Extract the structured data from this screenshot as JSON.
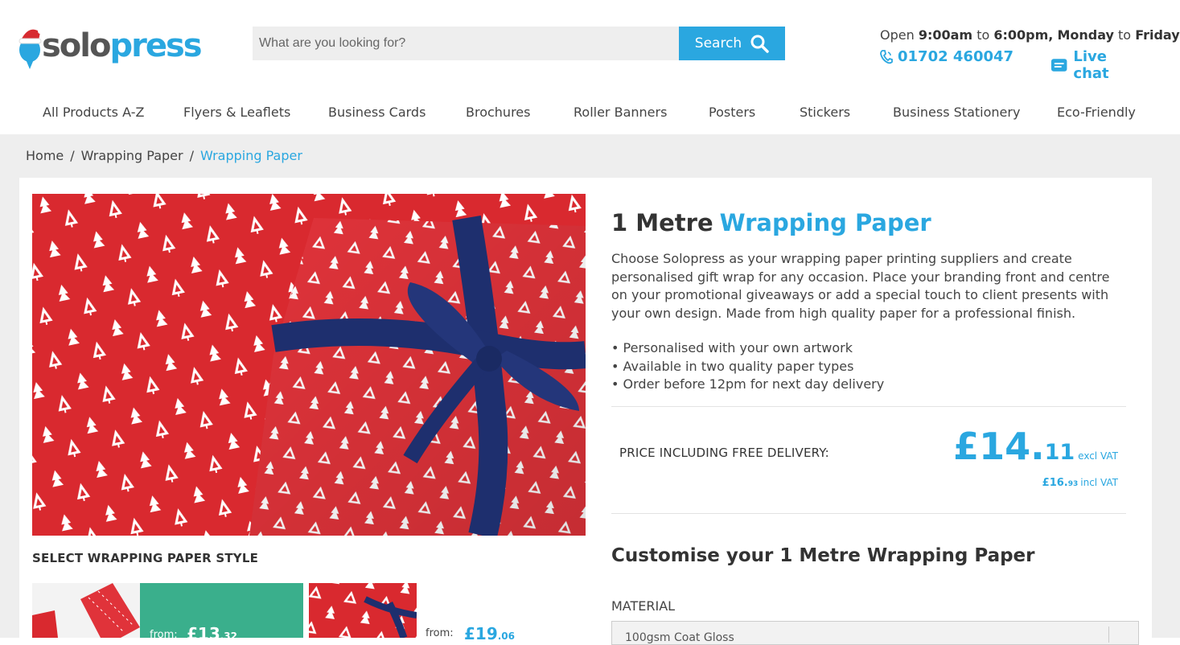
{
  "brand": {
    "logo_text_1": "solo",
    "logo_text_2": "press",
    "accent": "#2aa7e0",
    "green": "#3aaf8c"
  },
  "search": {
    "placeholder": "What are you looking for?",
    "button_label": "Search"
  },
  "hours": {
    "open_word": "Open",
    "open_time": "9:00am",
    "to1": "to",
    "close_time": "6:00pm,",
    "day_start": "Monday",
    "to2": "to",
    "day_end": "Friday"
  },
  "contact": {
    "phone": "01702 460047",
    "chat": "Live chat"
  },
  "nav": [
    {
      "label": "All Products A-Z"
    },
    {
      "label": "Flyers & Leaflets"
    },
    {
      "label": "Business Cards"
    },
    {
      "label": "Brochures"
    },
    {
      "label": "Roller Banners"
    },
    {
      "label": "Posters"
    },
    {
      "label": "Stickers"
    },
    {
      "label": "Business Stationery"
    },
    {
      "label": "Eco-Friendly"
    }
  ],
  "breadcrumb": {
    "items": [
      "Home",
      "Wrapping Paper",
      "Wrapping Paper"
    ],
    "sep": "/"
  },
  "product": {
    "title_prefix": "1 Metre",
    "title_suffix": "Wrapping Paper",
    "description": "Choose Solopress as your wrapping paper printing suppliers and create personalised gift wrap for any occasion. Place your branding front and centre on your promotional giveaways or add a special touch to client presents with your own design. Made from high quality paper for a professional finish.",
    "bullets": [
      "• Personalised with your own artwork",
      "• Available in two quality paper types",
      "• Order before 12pm for next day delivery"
    ]
  },
  "price": {
    "label": "PRICE INCLUDING FREE DELIVERY:",
    "main_whole": "£14.",
    "main_dec": "11",
    "main_vat": "excl VAT",
    "incl_whole": "£16.",
    "incl_dec": "93",
    "incl_vat": "incl VAT"
  },
  "styles": {
    "title": "SELECT WRAPPING PAPER STYLE",
    "options": [
      {
        "from": "from:",
        "price_whole": "£13",
        "price_dec": ".32",
        "selected": true
      },
      {
        "from": "from:",
        "price_whole": "£19",
        "price_dec": ".06",
        "selected": false
      }
    ]
  },
  "customise": {
    "title": "Customise your 1 Metre Wrapping Paper",
    "material_label": "MATERIAL",
    "material_value": "100gsm Coat Gloss"
  }
}
